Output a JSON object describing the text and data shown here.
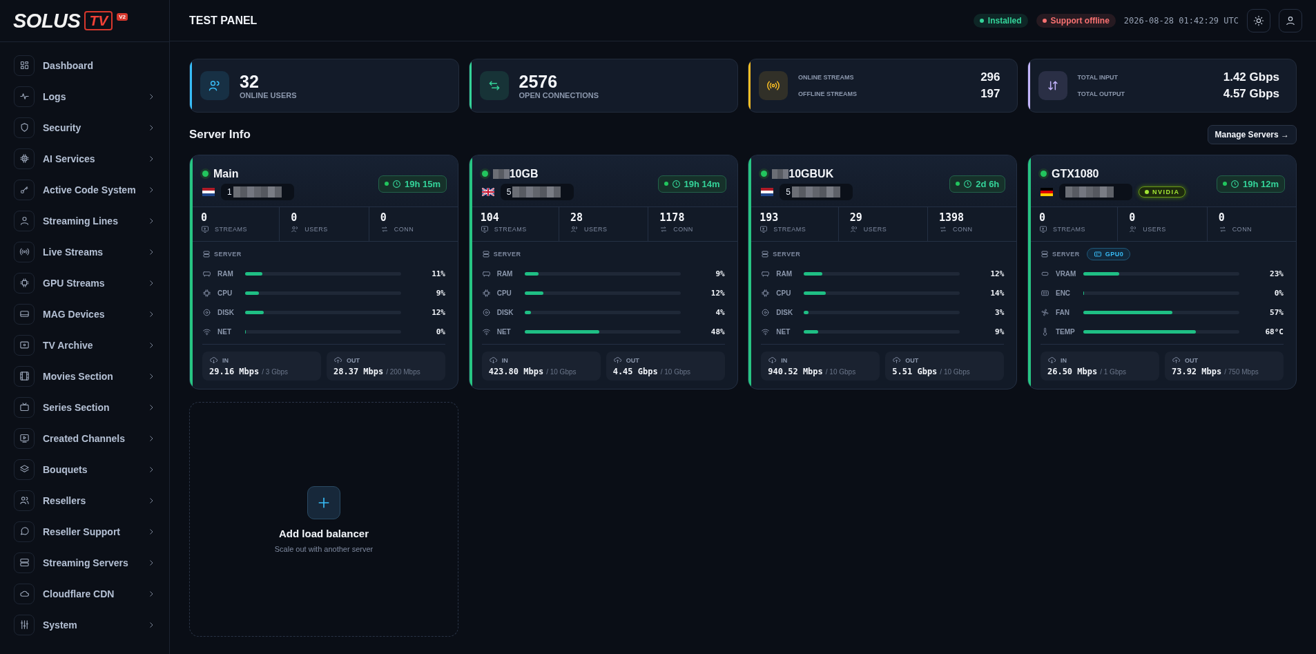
{
  "brand": {
    "name": "SOLUS",
    "mark": "TV",
    "version": "V2"
  },
  "sidebar": {
    "items": [
      {
        "label": "Dashboard",
        "expandable": false
      },
      {
        "label": "Logs",
        "expandable": true
      },
      {
        "label": "Security",
        "expandable": true
      },
      {
        "label": "AI Services",
        "expandable": true
      },
      {
        "label": "Active Code System",
        "expandable": true
      },
      {
        "label": "Streaming Lines",
        "expandable": true
      },
      {
        "label": "Live Streams",
        "expandable": true
      },
      {
        "label": "GPU Streams",
        "expandable": true
      },
      {
        "label": "MAG Devices",
        "expandable": true
      },
      {
        "label": "TV Archive",
        "expandable": true
      },
      {
        "label": "Movies Section",
        "expandable": true
      },
      {
        "label": "Series Section",
        "expandable": true
      },
      {
        "label": "Created Channels",
        "expandable": true
      },
      {
        "label": "Bouquets",
        "expandable": true
      },
      {
        "label": "Resellers",
        "expandable": true
      },
      {
        "label": "Reseller Support",
        "expandable": true
      },
      {
        "label": "Streaming Servers",
        "expandable": true
      },
      {
        "label": "Cloudflare CDN",
        "expandable": true
      },
      {
        "label": "System",
        "expandable": true
      }
    ]
  },
  "header": {
    "title": "TEST PANEL",
    "statuses": [
      {
        "label": "Installed",
        "color": "#34d399"
      },
      {
        "label": "Support offline",
        "color": "#f87171"
      }
    ],
    "clock": "2026-08-28 01:42:29 UTC"
  },
  "stats": [
    {
      "kind": "single",
      "color": "#38bdf8",
      "value": "32",
      "label": "ONLINE USERS"
    },
    {
      "kind": "single",
      "color": "#34d399",
      "value": "2576",
      "label": "OPEN CONNECTIONS"
    },
    {
      "kind": "pair",
      "color": "#fbbf24",
      "rows": [
        {
          "label": "ONLINE STREAMS",
          "value": "296"
        },
        {
          "label": "OFFLINE STREAMS",
          "value": "197"
        }
      ]
    },
    {
      "kind": "pair",
      "color": "#c4b5fd",
      "rows": [
        {
          "label": "TOTAL INPUT",
          "value": "1.42 Gbps"
        },
        {
          "label": "TOTAL OUTPUT",
          "value": "4.57 Gbps"
        }
      ]
    }
  ],
  "server_info": {
    "title": "Server Info",
    "action": "Manage Servers →",
    "servers": [
      {
        "name": "Main",
        "name_redacted": false,
        "online": true,
        "flag": {
          "kind": "nl"
        },
        "ip_prefix": "1",
        "ip_redacted": true,
        "uptime": "19h 15m",
        "counts": [
          {
            "value": "0",
            "label": "STREAMS"
          },
          {
            "value": "0",
            "label": "USERS"
          },
          {
            "value": "0",
            "label": "CONN"
          }
        ],
        "sources": [
          {
            "label": "SERVER",
            "selected": false
          }
        ],
        "metrics": [
          {
            "kind": "ram",
            "label": "RAM",
            "level": 0.11,
            "reading": "11%"
          },
          {
            "kind": "cpu",
            "label": "CPU",
            "level": 0.09,
            "reading": "9%"
          },
          {
            "kind": "disk",
            "label": "DISK",
            "level": 0.12,
            "reading": "12%"
          },
          {
            "kind": "net",
            "label": "NET",
            "level": 0,
            "reading": "0%"
          }
        ],
        "traffic": [
          {
            "kind": "in",
            "label": "IN",
            "value": "29.16 Mbps",
            "limit": "/ 3 Gbps"
          },
          {
            "kind": "out",
            "label": "OUT",
            "value": "28.37 Mbps",
            "limit": "/ 200 Mbps"
          }
        ]
      },
      {
        "name": "10GB",
        "name_redacted": true,
        "online": true,
        "flag": {
          "kind": "gb"
        },
        "ip_prefix": "5",
        "ip_redacted": true,
        "uptime": "19h 14m",
        "counts": [
          {
            "value": "104",
            "label": "STREAMS"
          },
          {
            "value": "28",
            "label": "USERS"
          },
          {
            "value": "1178",
            "label": "CONN"
          }
        ],
        "sources": [
          {
            "label": "SERVER",
            "selected": false
          }
        ],
        "metrics": [
          {
            "kind": "ram",
            "label": "RAM",
            "level": 0.09,
            "reading": "9%"
          },
          {
            "kind": "cpu",
            "label": "CPU",
            "level": 0.12,
            "reading": "12%"
          },
          {
            "kind": "disk",
            "label": "DISK",
            "level": 0.04,
            "reading": "4%"
          },
          {
            "kind": "net",
            "label": "NET",
            "level": 0.48,
            "reading": "48%"
          }
        ],
        "traffic": [
          {
            "kind": "in",
            "label": "IN",
            "value": "423.80 Mbps",
            "limit": "/ 10 Gbps"
          },
          {
            "kind": "out",
            "label": "OUT",
            "value": "4.45 Gbps",
            "limit": "/ 10 Gbps"
          }
        ]
      },
      {
        "name": "10GBUK",
        "name_redacted": true,
        "online": true,
        "flag": {
          "kind": "nl"
        },
        "ip_prefix": "5",
        "ip_redacted": true,
        "uptime": "2d 6h",
        "counts": [
          {
            "value": "193",
            "label": "STREAMS"
          },
          {
            "value": "29",
            "label": "USERS"
          },
          {
            "value": "1398",
            "label": "CONN"
          }
        ],
        "sources": [
          {
            "label": "SERVER",
            "selected": false
          }
        ],
        "metrics": [
          {
            "kind": "ram",
            "label": "RAM",
            "level": 0.12,
            "reading": "12%"
          },
          {
            "kind": "cpu",
            "label": "CPU",
            "level": 0.14,
            "reading": "14%"
          },
          {
            "kind": "disk",
            "label": "DISK",
            "level": 0.03,
            "reading": "3%"
          },
          {
            "kind": "net",
            "label": "NET",
            "level": 0.09,
            "reading": "9%"
          }
        ],
        "traffic": [
          {
            "kind": "in",
            "label": "IN",
            "value": "940.52 Mbps",
            "limit": "/ 10 Gbps"
          },
          {
            "kind": "out",
            "label": "OUT",
            "value": "5.51 Gbps",
            "limit": "/ 10 Gbps"
          }
        ]
      },
      {
        "name": "GTX1080",
        "name_redacted": false,
        "online": true,
        "flag": {
          "kind": "de"
        },
        "ip_redacted": true,
        "gpu_badge": "NVIDIA",
        "uptime": "19h 12m",
        "counts": [
          {
            "value": "0",
            "label": "STREAMS"
          },
          {
            "value": "0",
            "label": "USERS"
          },
          {
            "value": "0",
            "label": "CONN"
          }
        ],
        "sources": [
          {
            "label": "SERVER",
            "selected": false
          },
          {
            "label": "GPU0",
            "selected": true
          }
        ],
        "metrics": [
          {
            "kind": "vram",
            "label": "VRAM",
            "level": 0.23,
            "reading": "23%"
          },
          {
            "kind": "enc",
            "label": "ENC",
            "level": 0,
            "reading": "0%"
          },
          {
            "kind": "fan",
            "label": "FAN",
            "level": 0.57,
            "reading": "57%"
          },
          {
            "kind": "temp",
            "label": "TEMP",
            "level": 0.72,
            "reading": "68°C"
          }
        ],
        "traffic": [
          {
            "kind": "in",
            "label": "IN",
            "value": "26.50 Mbps",
            "limit": "/ 1 Gbps"
          },
          {
            "kind": "out",
            "label": "OUT",
            "value": "73.92 Mbps",
            "limit": "/ 750 Mbps"
          }
        ]
      }
    ],
    "add_card": {
      "title": "Add load balancer",
      "subtitle": "Scale out with another server"
    }
  }
}
